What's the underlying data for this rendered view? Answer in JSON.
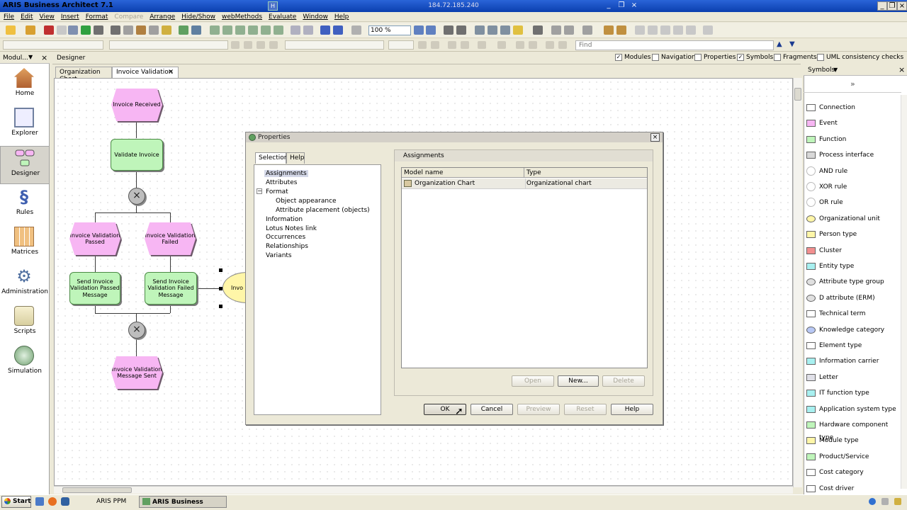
{
  "window": {
    "title": "ARIS Business Architect 7.1",
    "remote_host": "184.72.185.240",
    "remote_badge": "H"
  },
  "menu": [
    {
      "label": "File",
      "disabled": false
    },
    {
      "label": "Edit",
      "disabled": false
    },
    {
      "label": "View",
      "disabled": false
    },
    {
      "label": "Insert",
      "disabled": false
    },
    {
      "label": "Format",
      "disabled": false
    },
    {
      "label": "Compare",
      "disabled": true
    },
    {
      "label": "Arrange",
      "disabled": false
    },
    {
      "label": "Hide/Show",
      "disabled": false
    },
    {
      "label": "webMethods",
      "disabled": false
    },
    {
      "label": "Evaluate",
      "disabled": false
    },
    {
      "label": "Window",
      "disabled": false
    },
    {
      "label": "Help",
      "disabled": false
    }
  ],
  "toolbar": {
    "zoom": "100 %",
    "find_placeholder": "Find"
  },
  "left_panel": {
    "title": "Modul...",
    "items": [
      "Home",
      "Explorer",
      "Designer",
      "Rules",
      "Matrices",
      "Administration",
      "Scripts",
      "Simulation"
    ]
  },
  "designer": {
    "title": "Designer",
    "checks": [
      {
        "label": "Modules",
        "checked": true
      },
      {
        "label": "Navigation",
        "checked": false
      },
      {
        "label": "Properties",
        "checked": false
      },
      {
        "label": "Symbols",
        "checked": true
      },
      {
        "label": "Fragments",
        "checked": false
      },
      {
        "label": "UML consistency checks",
        "checked": false
      }
    ],
    "tabs": [
      "Organization Chart",
      "Invoice Validation"
    ]
  },
  "diagram": {
    "invoice_received": "Invoice Received",
    "validate_invoice": "Validate Invoice",
    "passed": "Invoice Validation Passed",
    "failed": "Invoice Validation Failed",
    "send_passed": "Send Invoice Validation Passed Message",
    "send_failed": "Send Invoice Validation Failed Message",
    "sent": "Invoice Validation Message Sent",
    "org_fragment": "Invo",
    "xor_symbol": "×"
  },
  "dialog": {
    "title": "Properties",
    "tabs": [
      "Selection",
      "Help"
    ],
    "tree": [
      "Assignments",
      "Attributes",
      "Format",
      "Object appearance",
      "Attribute placement (objects)",
      "Information",
      "Lotus Notes link",
      "Occurrences",
      "Relationships",
      "Variants"
    ],
    "group_title": "Assignments",
    "columns": [
      "Model name",
      "Type"
    ],
    "rows": [
      {
        "model": "Organization Chart",
        "type": "Organizational chart"
      }
    ],
    "table_buttons": [
      "Open",
      "New...",
      "Delete"
    ],
    "buttons": [
      "OK",
      "Cancel",
      "Preview",
      "Reset",
      "Help"
    ]
  },
  "symbols": {
    "title": "Symbols",
    "items": [
      {
        "label": "Connection",
        "color": "#ffffff"
      },
      {
        "label": "Event",
        "color": "#f7b6f3"
      },
      {
        "label": "Function",
        "color": "#bff5ba"
      },
      {
        "label": "Process interface",
        "color": "#d8d8d8"
      },
      {
        "label": "AND rule",
        "color": "#ffffff"
      },
      {
        "label": "XOR rule",
        "color": "#ffffff"
      },
      {
        "label": "OR rule",
        "color": "#ffffff"
      },
      {
        "label": "Organizational unit",
        "color": "#fff6a8"
      },
      {
        "label": "Person type",
        "color": "#fff6a8"
      },
      {
        "label": "Cluster",
        "color": "#f28f8f"
      },
      {
        "label": "Entity type",
        "color": "#a8f0f0"
      },
      {
        "label": "Attribute type group",
        "color": "#e0e0e0"
      },
      {
        "label": "D attribute (ERM)",
        "color": "#e0e0e0"
      },
      {
        "label": "Technical term",
        "color": "#ffffff"
      },
      {
        "label": "Knowledge category",
        "color": "#b8c8f5"
      },
      {
        "label": "Element type",
        "color": "#ffffff"
      },
      {
        "label": "Information carrier",
        "color": "#a8f0f0"
      },
      {
        "label": "Letter",
        "color": "#e0e0e8"
      },
      {
        "label": "IT function type",
        "color": "#a8f0f0"
      },
      {
        "label": "Application system type",
        "color": "#a8f0f0"
      },
      {
        "label": "Hardware component type",
        "color": "#bff5ba"
      },
      {
        "label": "Module type",
        "color": "#fff6a8"
      },
      {
        "label": "Product/Service",
        "color": "#bff5ba"
      },
      {
        "label": "Cost category",
        "color": "#ffffff"
      },
      {
        "label": "Cost driver",
        "color": "#ffffff"
      }
    ]
  },
  "taskbar": {
    "start": "Start",
    "tasks": [
      "ARIS PPM",
      "ARIS Business Archit..."
    ]
  }
}
